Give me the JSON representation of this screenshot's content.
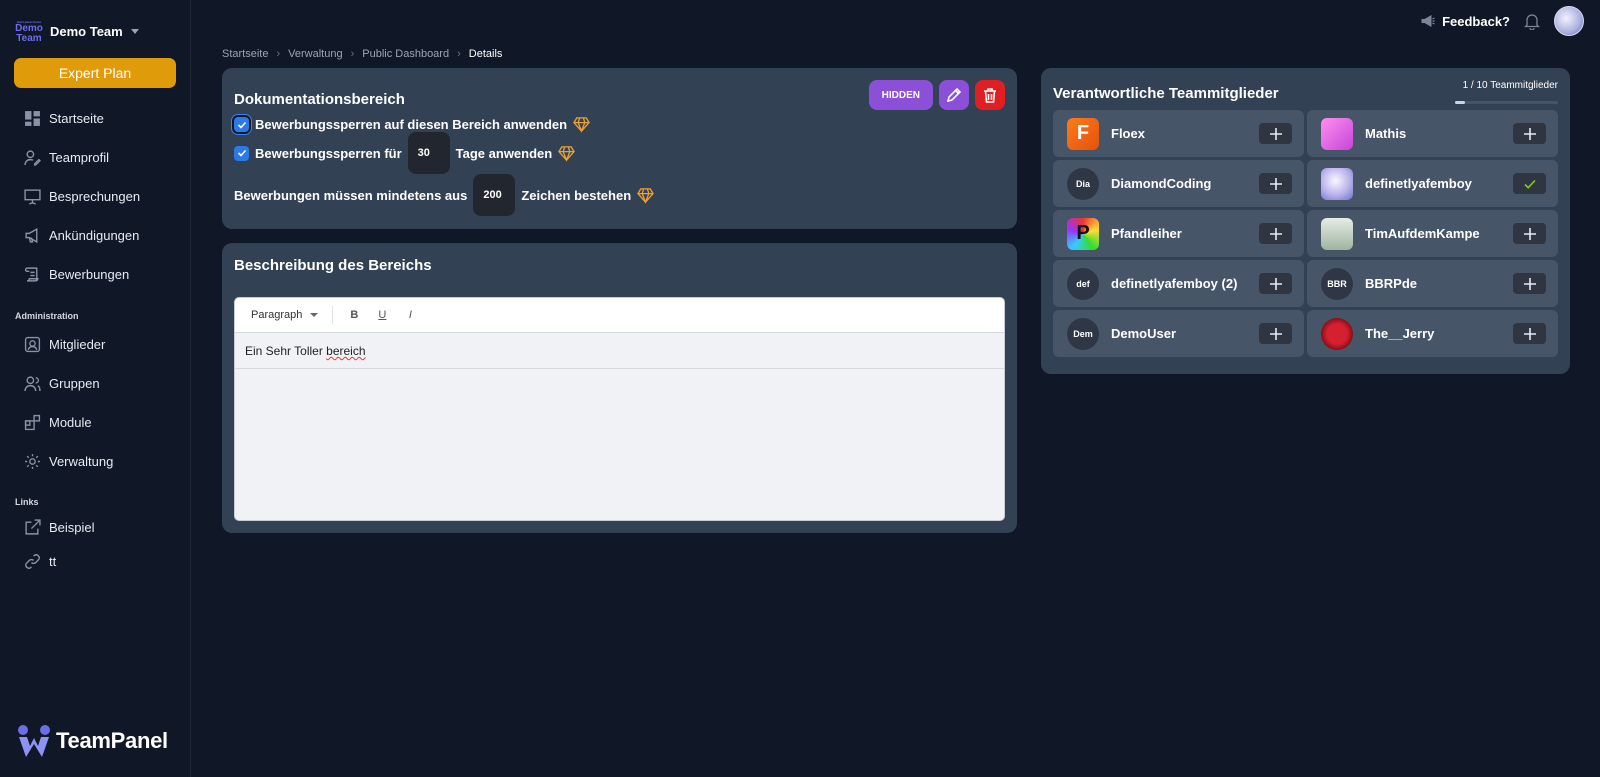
{
  "team": {
    "logo_tiny": "team panel demo",
    "logo_line1": "Demo",
    "logo_line2": "Team",
    "name": "Demo Team"
  },
  "plan_label": "Expert Plan",
  "nav_main": [
    {
      "label": "Startseite",
      "icon": "dashboard-icon"
    },
    {
      "label": "Teamprofil",
      "icon": "user-edit-icon"
    },
    {
      "label": "Besprechungen",
      "icon": "presentation-icon"
    },
    {
      "label": "Ankündigungen",
      "icon": "megaphone-icon"
    },
    {
      "label": "Bewerbungen",
      "icon": "scroll-icon"
    }
  ],
  "section_admin": "Administration",
  "nav_admin": [
    {
      "label": "Mitglieder",
      "icon": "contact-icon"
    },
    {
      "label": "Gruppen",
      "icon": "users-icon"
    },
    {
      "label": "Module",
      "icon": "blocks-icon"
    },
    {
      "label": "Verwaltung",
      "icon": "gear-icon"
    }
  ],
  "section_links": "Links",
  "nav_links": [
    {
      "label": "Beispiel",
      "icon": "external-link-icon"
    },
    {
      "label": "tt",
      "icon": "link-icon"
    }
  ],
  "brand": "TeamPanel",
  "topbar": {
    "feedback": "Feedback?"
  },
  "breadcrumb": [
    "Startseite",
    "Verwaltung",
    "Public Dashboard",
    "Details"
  ],
  "settings": {
    "title": "Dokumentationsbereich",
    "hidden_label": "HIDDEN",
    "lock_label": "Bewerbungssperren auf diesen Bereich anwenden",
    "lock_days_prefix": "Bewerbungssperren für",
    "lock_days_value": "30",
    "lock_days_suffix": "Tage anwenden",
    "min_chars_prefix": "Bewerbungen müssen mindetens aus",
    "min_chars_value": "200",
    "min_chars_suffix": "Zeichen bestehen"
  },
  "description": {
    "title": "Beschreibung des Bereichs",
    "block_type": "Paragraph",
    "bold": "B",
    "underline": "U",
    "italic": "I",
    "content_a": "Ein Sehr Toller ",
    "content_b": "bereich"
  },
  "members": {
    "title": "Verantwortliche Teammitglieder",
    "counter": "1 / 10 Teammitglieder",
    "counter_fraction": 0.1,
    "list": [
      {
        "name": "Floex",
        "avatar": "floex",
        "initials": "",
        "selected": false
      },
      {
        "name": "Mathis",
        "avatar": "mathis",
        "initials": "",
        "selected": false
      },
      {
        "name": "DiamondCoding",
        "avatar": "initials",
        "initials": "Dia",
        "selected": false
      },
      {
        "name": "definetlyafemboy",
        "avatar": "anime",
        "initials": "",
        "selected": true
      },
      {
        "name": "Pfandleiher",
        "avatar": "pfand",
        "initials": "",
        "selected": false
      },
      {
        "name": "TimAufdemKampe",
        "avatar": "tim",
        "initials": "",
        "selected": false
      },
      {
        "name": "definetlyafemboy (2)",
        "avatar": "initials",
        "initials": "def",
        "selected": false
      },
      {
        "name": "BBRPde",
        "avatar": "initials",
        "initials": "BBR",
        "selected": false
      },
      {
        "name": "DemoUser",
        "avatar": "initials",
        "initials": "Dem",
        "selected": false
      },
      {
        "name": "The__Jerry",
        "avatar": "jerry",
        "initials": "",
        "selected": false
      }
    ]
  },
  "colors": {
    "accent_purple": "#8c4fd7",
    "danger": "#e01f24",
    "plan": "#e09b0b",
    "checkbox": "#2b7ae6",
    "check_green": "#84cc16",
    "gem": "#f0a030"
  }
}
